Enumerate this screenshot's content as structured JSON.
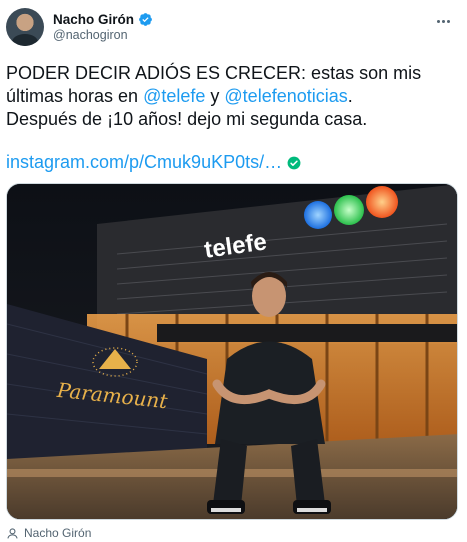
{
  "tweet": {
    "author": {
      "display_name": "Nacho Girón",
      "handle": "@nachogiron",
      "verified": true
    },
    "text_lines": [
      {
        "before": "PODER DECIR ADIÓS ES CRECER: estas son mis",
        "mention1": "",
        "middle": "",
        "mention2": "",
        "after": ""
      },
      {
        "before": "últimas horas en ",
        "mention1": "@telefe",
        "middle": " y ",
        "mention2": "@telefenoticias",
        "after": "."
      },
      {
        "before": "Después de ¡10 años! dejo mi segunda casa.",
        "mention1": "",
        "middle": "",
        "mention2": "",
        "after": ""
      }
    ],
    "link_text": "instagram.com/p/Cmuk9uKP0ts/…",
    "media": {
      "building_sign": "telefe",
      "wall_logo": "Paramount"
    },
    "footer_tagged_user": "Nacho Girón"
  },
  "colors": {
    "accent": "#1d9bf0",
    "secondary_text": "#536471",
    "verified_green": "#00ba7c"
  },
  "icons": [
    "verified-badge-icon",
    "more-options-icon",
    "verified-link-icon",
    "person-icon"
  ]
}
